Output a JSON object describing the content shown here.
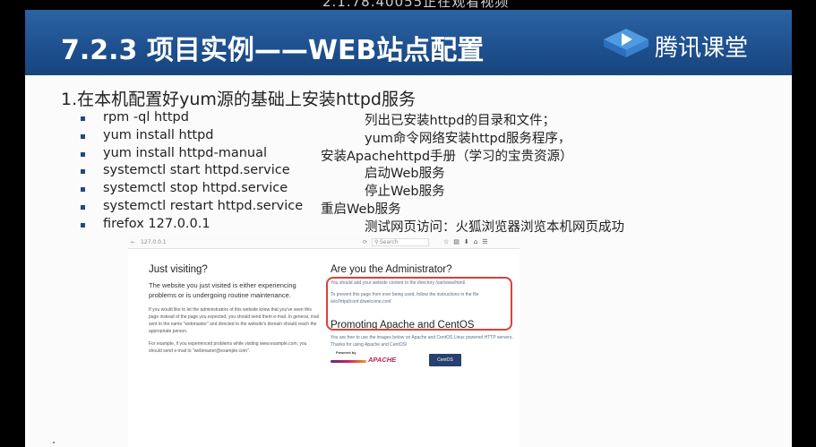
{
  "overlay_text": "2.1.78.40055正在观看视频",
  "slide": {
    "title": "7.2.3  项目实例——WEB站点配置",
    "logo_text": "腾讯课堂",
    "heading": "1.在本机配置好yum源的基础上安装httpd服务",
    "commands": [
      {
        "cmd": "rpm -ql httpd",
        "desc": "列出已安装httpd的目录和文件；"
      },
      {
        "cmd": "yum install httpd",
        "desc": "yum命令网络安装httpd服务程序，"
      },
      {
        "cmd": "yum install httpd-manual",
        "desc": "安装Apachehttpd手册（学习的宝贵资源）"
      },
      {
        "cmd": "systemctl start httpd.service",
        "desc": "启动Web服务"
      },
      {
        "cmd": "systemctl stop httpd.service",
        "desc": "停止Web服务"
      },
      {
        "cmd": "systemctl restart httpd.service",
        "desc": "重启Web服务"
      },
      {
        "cmd": "firefox 127.0.0.1",
        "desc": "测试网页访问：火狐浏览器浏览本机网页成功"
      }
    ]
  },
  "browser": {
    "url": "127.0.0.1",
    "search_placeholder": "Search",
    "left": {
      "heading": "Just visiting?",
      "lead": "The website you just visited is either experiencing problems or is undergoing routine maintenance.",
      "p1": "If you would like to let the administrators of this website know that you've seen this page instead of the page you expected, you should send them e-mail. In general, mail sent to the name \"webmaster\" and directed to the website's domain should reach the appropriate person.",
      "p2": "For example, if you experienced problems while visiting www.example.com, you should send e-mail to \"webmaster@example.com\"."
    },
    "right": {
      "heading": "Are you the Administrator?",
      "p1": "You should add your website content to the directory /var/www/html/.",
      "p2": "To prevent this page from ever being used, follow the instructions in the file /etc/httpd/conf.d/welcome.conf.",
      "promo_heading": "Promoting Apache and CentOS",
      "promo_text": "You are free to use the images below on Apache and CentOS Linux powered HTTP servers. Thanks for using Apache and CentOS!",
      "powered_by": "Powered by",
      "apache_badge": "APACHE",
      "centos_badge": "CentOS"
    }
  }
}
